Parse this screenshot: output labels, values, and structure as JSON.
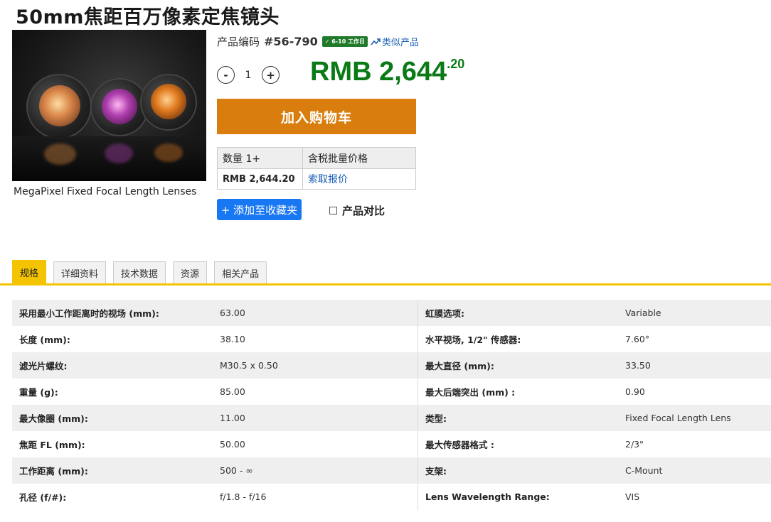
{
  "product": {
    "title": "50mm焦距百万像素定焦镜头",
    "image_caption": "MegaPixel Fixed Focal Length Lenses",
    "code_label": "产品编码",
    "code": "#56-790",
    "lead_time_badge": "6-10 工作日",
    "similar_label": "类似产品"
  },
  "purchase": {
    "minus_label": "-",
    "quantity": "1",
    "plus_label": "+",
    "price_main": "RMB 2,644",
    "price_cents": ".20",
    "add_to_cart": "加入购物车",
    "add_to_favorites": "+ 添加至收藏夹",
    "compare_label": "产品对比"
  },
  "price_table": {
    "col_qty": "数量 1+",
    "col_price": "含税批量价格",
    "qty_price": "RMB 2,644.20",
    "quote_link": "索取报价"
  },
  "tabs": [
    "规格",
    "详细资料",
    "技术数据",
    "资源",
    "相关产品"
  ],
  "specs": [
    {
      "k1": "采用最小工作距离时的视场 (mm):",
      "v1": "63.00",
      "k2": "虹膜选项:",
      "v2": "Variable"
    },
    {
      "k1": "长度 (mm):",
      "v1": "38.10",
      "k2": "水平视场, 1/2\" 传感器:",
      "v2": "7.60°"
    },
    {
      "k1": "滤光片螺纹:",
      "v1": "M30.5 x 0.50",
      "k2": "最大直径 (mm):",
      "v2": "33.50"
    },
    {
      "k1": "重量 (g):",
      "v1": "85.00",
      "k2": "最大后端突出 (mm) :",
      "v2": "0.90"
    },
    {
      "k1": "最大像圈 (mm):",
      "v1": "11.00",
      "k2": "类型:",
      "v2": "Fixed Focal Length Lens"
    },
    {
      "k1": "焦距 FL (mm):",
      "v1": "50.00",
      "k2": "最大传感器格式 :",
      "v2": "2/3\""
    },
    {
      "k1": "工作距离 (mm):",
      "v1": "500 - ∞",
      "k2": "支架:",
      "v2": "C-Mount"
    },
    {
      "k1": "孔径 (f/#):",
      "v1": "f/1.8 - f/16",
      "k2": "Lens Wavelength Range:",
      "v2": "VIS"
    }
  ],
  "colors": {
    "price_green": "#0a7a16",
    "cart_orange": "#d97e0e",
    "fav_blue": "#1877f2",
    "tab_yellow": "#f5c400",
    "link_blue": "#1a5fb4"
  },
  "icons": {
    "badge_check": "check-icon",
    "similar": "trend-chart-icon"
  }
}
